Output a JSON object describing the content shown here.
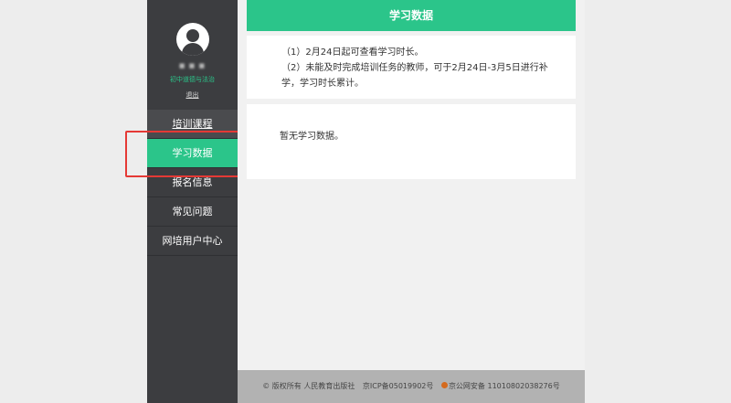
{
  "sidebar": {
    "user_name": "■ ■ ■",
    "user_subject": "初中道德与法治",
    "logout_label": "退出",
    "items": [
      {
        "label": "培训课程"
      },
      {
        "label": "学习数据"
      },
      {
        "label": "报名信息"
      },
      {
        "label": "常见问题"
      },
      {
        "label": "网培用户中心"
      }
    ],
    "active_index": 1
  },
  "main": {
    "title": "学习数据",
    "notice_lines": [
      "（1）2月24日起可查看学习时长。",
      "（2）未能及时完成培训任务的教师，可于2月24日-3月5日进行补学，学习时长累计。"
    ],
    "empty_message": "暂无学习数据。"
  },
  "footer": {
    "copyright": "© 版权所有  人民教育出版社",
    "icp": "京ICP备05019902号",
    "police": "京公网安备 11010802038276号"
  },
  "colors": {
    "accent": "#2bc58a",
    "sidebar": "#3c3d40",
    "highlight": "#e53935"
  },
  "icons": {
    "avatar": "user-avatar-icon",
    "police": "police-badge-icon"
  }
}
